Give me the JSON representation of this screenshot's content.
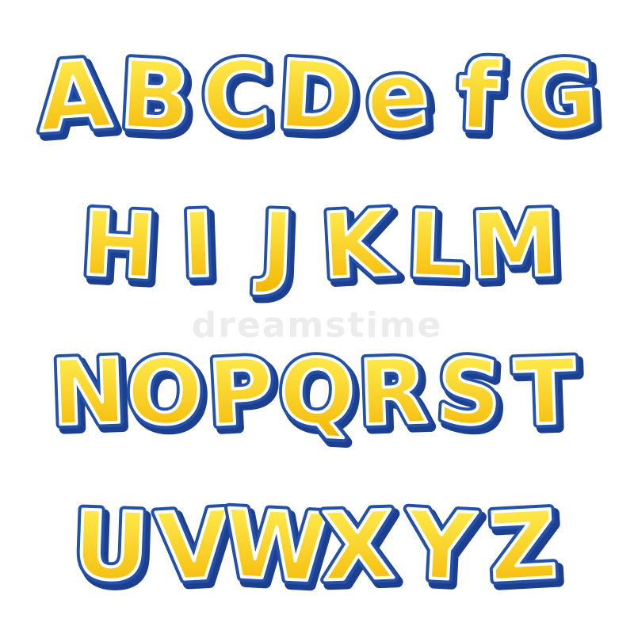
{
  "alphabet": {
    "rows": [
      [
        "A",
        "B",
        "C",
        "D",
        "e",
        "f",
        "G"
      ],
      [
        "H",
        "I",
        "J",
        "K",
        "L",
        "M"
      ],
      [
        "N",
        "O",
        "P",
        "Q",
        "R",
        "S",
        "T"
      ],
      [
        "U",
        "V",
        "W",
        "X",
        "Y",
        "Z"
      ]
    ]
  },
  "colors": {
    "fill_top": "#fff45a",
    "fill_bottom": "#f4b400",
    "outline": "#2451a8",
    "shadow": "#1d3f8f",
    "background": "#ffffff"
  },
  "watermark": {
    "text": "dreamstime"
  }
}
